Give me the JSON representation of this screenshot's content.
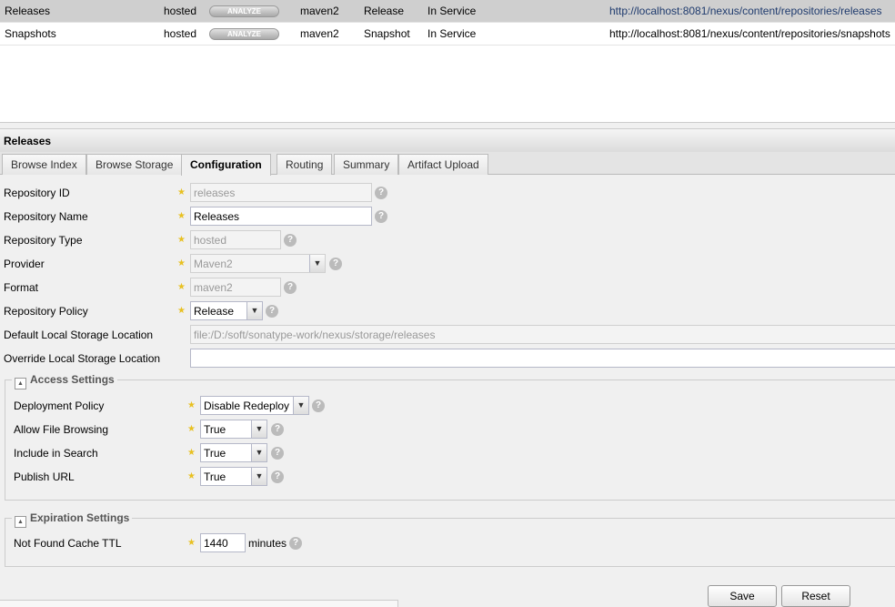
{
  "grid": {
    "rows": [
      {
        "name": "Releases",
        "type": "hosted",
        "analyze": "ANALYZE",
        "format": "maven2",
        "policy": "Release",
        "status": "In Service",
        "url": "http://localhost:8081/nexus/content/repositories/releases"
      },
      {
        "name": "Snapshots",
        "type": "hosted",
        "analyze": "ANALYZE",
        "format": "maven2",
        "policy": "Snapshot",
        "status": "In Service",
        "url": "http://localhost:8081/nexus/content/repositories/snapshots"
      }
    ]
  },
  "panel": {
    "title": "Releases",
    "tabs": [
      "Browse Index",
      "Browse Storage",
      "Configuration",
      "Routing",
      "Summary",
      "Artifact Upload"
    ],
    "active_tab": "Configuration"
  },
  "form": {
    "repo_id": {
      "label": "Repository ID",
      "value": "releases"
    },
    "repo_name": {
      "label": "Repository Name",
      "value": "Releases"
    },
    "repo_type": {
      "label": "Repository Type",
      "value": "hosted"
    },
    "provider": {
      "label": "Provider",
      "value": "Maven2"
    },
    "format": {
      "label": "Format",
      "value": "maven2"
    },
    "policy": {
      "label": "Repository Policy",
      "value": "Release"
    },
    "default_storage": {
      "label": "Default Local Storage Location",
      "value": "file:/D:/soft/sonatype-work/nexus/storage/releases"
    },
    "override_storage": {
      "label": "Override Local Storage Location",
      "value": ""
    }
  },
  "access": {
    "legend": "Access Settings",
    "deployment": {
      "label": "Deployment Policy",
      "value": "Disable Redeploy"
    },
    "browsing": {
      "label": "Allow File Browsing",
      "value": "True"
    },
    "search": {
      "label": "Include in Search",
      "value": "True"
    },
    "publish": {
      "label": "Publish URL",
      "value": "True"
    }
  },
  "expiration": {
    "legend": "Expiration Settings",
    "ttl": {
      "label": "Not Found Cache TTL",
      "value": "1440",
      "unit": "minutes"
    }
  },
  "buttons": {
    "save": "Save",
    "reset": "Reset"
  }
}
